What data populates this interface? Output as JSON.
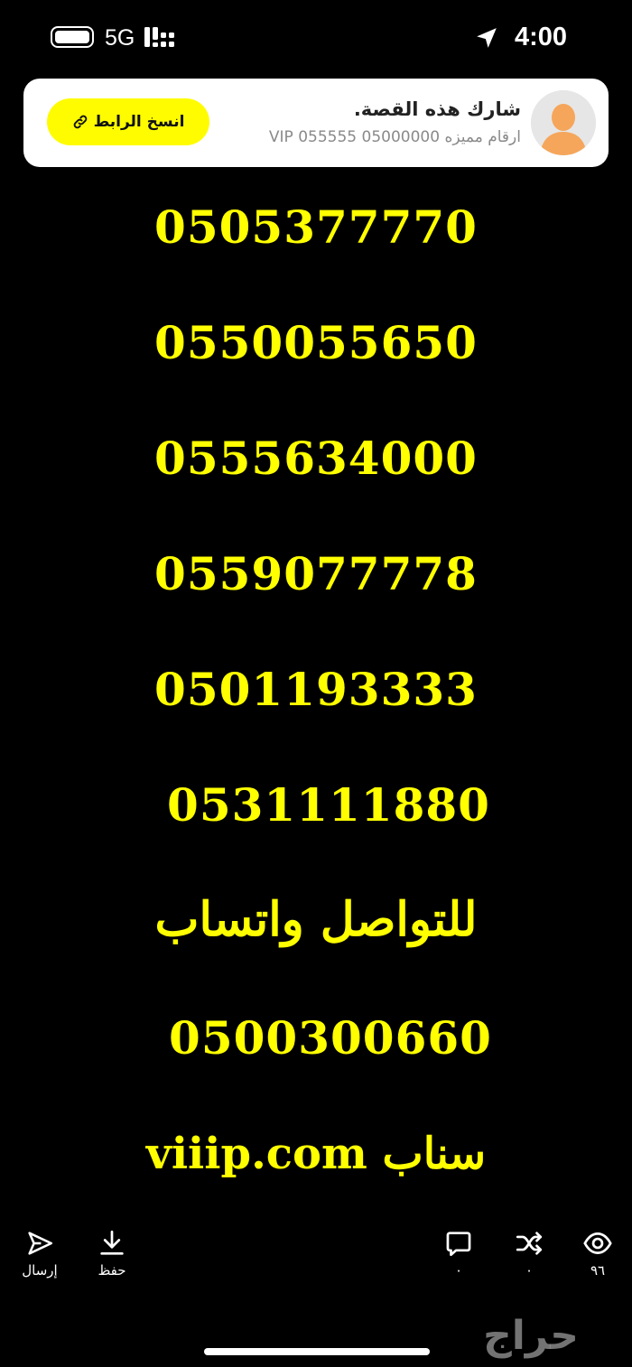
{
  "status_bar": {
    "network": "5G",
    "time": "4:00"
  },
  "share_card": {
    "title": "شارك هذه القصة.",
    "subtitle": "ارقام مميزه 05000000 055555 VIP",
    "copy_button": "انسخ الرابط"
  },
  "story": {
    "numbers": [
      "0505377770",
      "0550055650",
      "0555634000",
      "0559077778",
      "0501193333",
      "0531111880"
    ],
    "contact_text": "للتواصل واتساب",
    "contact_number": "0500300660",
    "snap_text": "سناب viiip.com"
  },
  "actions": {
    "send_label": "إرسال",
    "save_label": "حفظ",
    "comments_count": "٠",
    "shares_count": "٠",
    "views_count": "٩٦"
  },
  "watermark_text": "حراج",
  "colors": {
    "story_text": "#ffff00",
    "button_yellow": "#fffc00",
    "background": "#000000"
  }
}
